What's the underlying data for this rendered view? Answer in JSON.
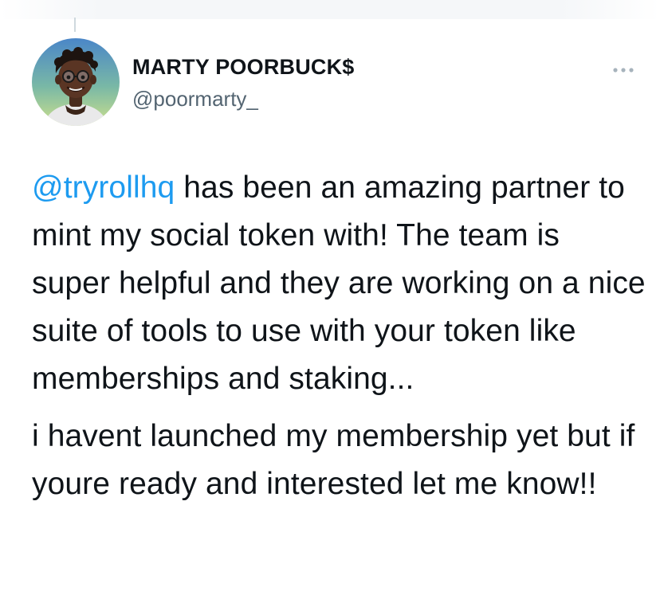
{
  "tweet": {
    "author": {
      "display_name": "MARTY POORBUCK$",
      "handle": "@poormarty_",
      "avatar_icon": "avatar-3d-character"
    },
    "more_icon": "more-horizontal-icon",
    "colors": {
      "text": "#0f1419",
      "secondary_text": "#536471",
      "link": "#1d9bf0"
    },
    "paragraph_1": {
      "mention": "@tryrollhq",
      "text": " has been an amazing partner to mint my social token with! The team is super helpful and they are working on a nice suite of tools to use with your token like memberships and staking..."
    },
    "paragraph_2": {
      "text": "i havent launched my membership yet but if youre ready and interested let me know!!"
    }
  }
}
